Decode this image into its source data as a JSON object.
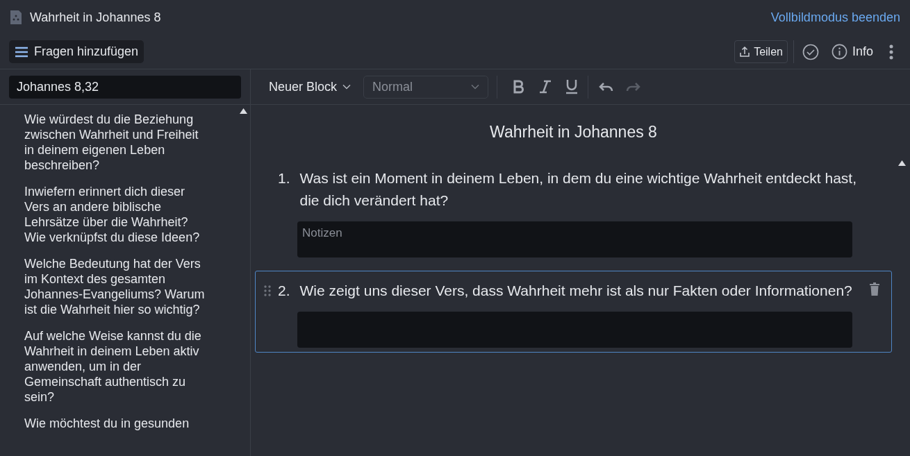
{
  "window": {
    "title": "Wahrheit in Johannes 8",
    "exit_fullscreen": "Vollbildmodus beenden"
  },
  "toolbar": {
    "add_questions": "Fragen hinzufügen",
    "share": "Teilen",
    "info": "Info"
  },
  "sidebar": {
    "search": {
      "value": "Johannes 8,32"
    },
    "items": [
      "Wie würdest du die Beziehung zwischen Wahrheit und Freiheit in deinem eigenen Leben beschreiben?",
      "Inwiefern erinnert dich dieser Vers an andere biblische Lehrsätze über die Wahrheit? Wie verknüpfst du diese Ideen?",
      "Welche Bedeutung hat der Vers im Kontext des gesamten Johannes-Evangeliums? Warum ist die Wahrheit hier so wichtig?",
      "Auf welche Weise kannst du die Wahrheit in deinem Leben aktiv anwenden, um in der Gemeinschaft authentisch zu sein?",
      "Wie möchtest du in gesunden"
    ]
  },
  "editor_toolbar": {
    "block": "Neuer Block",
    "style": "Normal",
    "history": [
      {
        "kind": "undo",
        "disabled": false
      },
      {
        "kind": "redo",
        "disabled": true
      }
    ]
  },
  "document": {
    "title": "Wahrheit in Johannes 8",
    "questions": [
      {
        "number": "1.",
        "text": "Was ist ein Moment in deinem Leben, in dem du eine wichtige Wahrheit entdeckt hast, die dich verändert hat?",
        "placeholder": "Notizen",
        "selected": false
      },
      {
        "number": "2.",
        "text": "Wie zeigt uns dieser Vers, dass Wahrheit mehr ist als nur Fakten oder Informationen?",
        "selected": true
      }
    ]
  }
}
